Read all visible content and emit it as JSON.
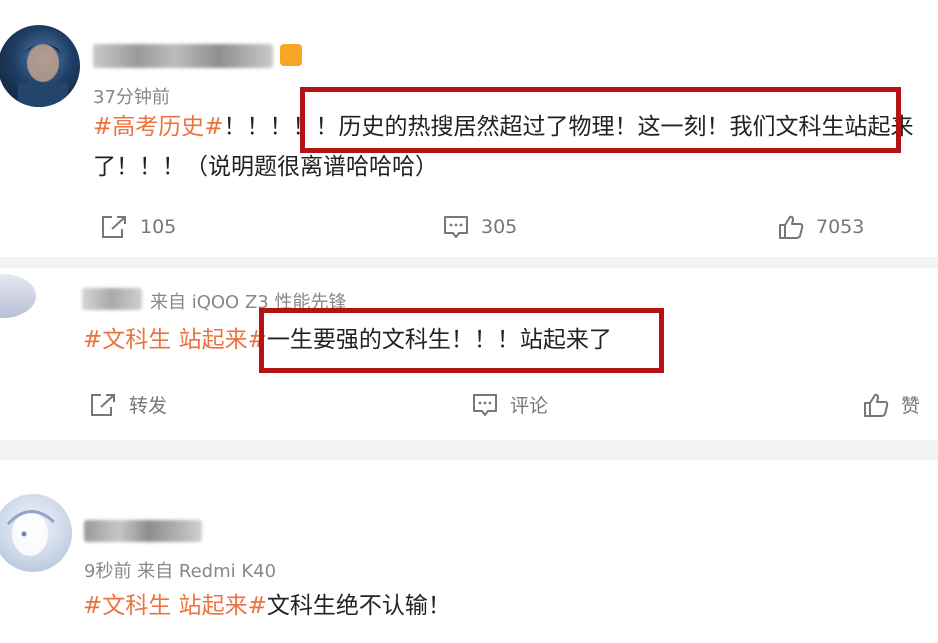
{
  "posts": [
    {
      "time": "37分钟前",
      "tag": "#高考历史#",
      "text_pre": "！！！！！",
      "text_highlight": "历史的热搜居然超过了物理！这一刻！我们文科生站起来",
      "text_line2": "了！！！（说明题很离谱哈哈哈）",
      "actions": {
        "share": "105",
        "comment": "305",
        "like": "7053"
      }
    },
    {
      "meta": "来自 iQOO Z3 性能先锋",
      "tag": "#文科生 站起来#",
      "text_highlight": "一生要强的文科生！！！站起来了",
      "actions": {
        "share": "转发",
        "comment": "评论",
        "like": "赞"
      }
    },
    {
      "meta": "9秒前  来自 Redmi K40",
      "tag": "#文科生 站起来#",
      "text": "文科生绝不认输！"
    }
  ],
  "colors": {
    "tag": "#eb7340",
    "highlight_border": "#b31217",
    "text": "#222222",
    "muted": "#888888"
  },
  "icons": [
    "share-icon",
    "comment-icon",
    "like-icon"
  ]
}
